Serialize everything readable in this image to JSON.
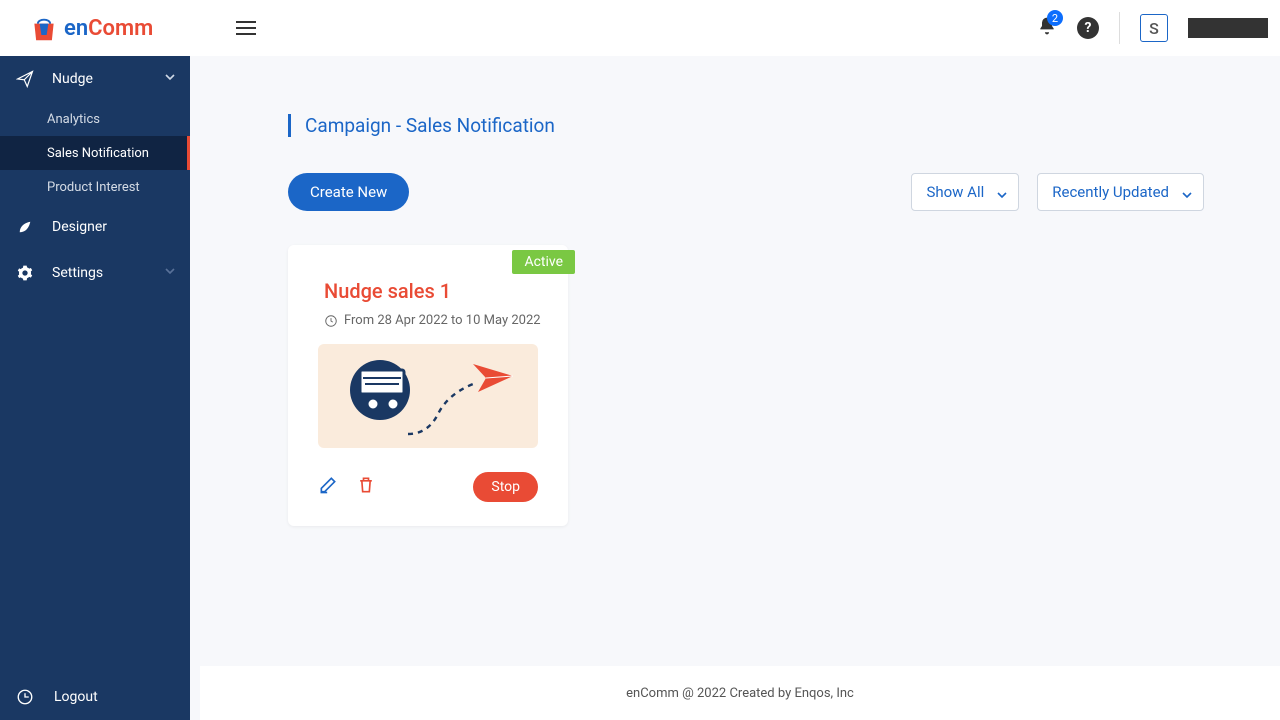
{
  "header": {
    "logo_en": "en",
    "logo_comm": "Comm",
    "notification_count": "2",
    "avatar_letter": "S"
  },
  "sidebar": {
    "nudge": "Nudge",
    "analytics": "Analytics",
    "sales_notification": "Sales Notification",
    "product_interest": "Product Interest",
    "designer": "Designer",
    "settings": "Settings",
    "logout": "Logout"
  },
  "main": {
    "page_title": "Campaign  - Sales Notification",
    "create_label": "Create New",
    "filter_show": "Show All",
    "filter_sort": "Recently Updated"
  },
  "card": {
    "status": "Active",
    "title": "Nudge sales 1",
    "date_range": "From 28 Apr 2022 to 10 May 2022",
    "stop_label": "Stop"
  },
  "footer": {
    "text": "enComm @ 2022 Created by Enqos, Inc"
  }
}
